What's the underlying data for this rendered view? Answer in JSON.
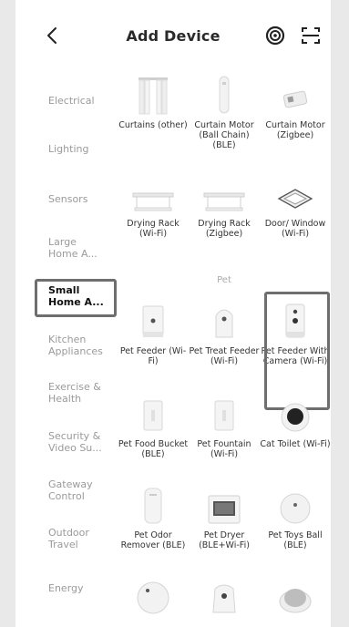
{
  "header": {
    "title": "Add Device",
    "back_icon": "chevron-left-icon",
    "target_icon": "target-icon",
    "scan_icon": "scan-icon"
  },
  "sidebar": {
    "items": [
      {
        "label": "Electrical",
        "active": false
      },
      {
        "label": "Lighting",
        "active": false
      },
      {
        "label": "Sensors",
        "active": false
      },
      {
        "label": "Large Home A...",
        "active": false
      },
      {
        "label": "Small Home A...",
        "active": true
      },
      {
        "label": "Kitchen Appliances",
        "active": false
      },
      {
        "label": "Exercise & Health",
        "active": false
      },
      {
        "label": "Security & Video Su...",
        "active": false
      },
      {
        "label": "Gateway Control",
        "active": false
      },
      {
        "label": "Outdoor Travel",
        "active": false
      },
      {
        "label": "Energy",
        "active": false
      }
    ]
  },
  "sections": {
    "pet_title": "Pet"
  },
  "devices": [
    {
      "label": "Curtains (other)"
    },
    {
      "label": "Curtain Motor (Ball Chain) (BLE)"
    },
    {
      "label": "Curtain Motor (Zigbee)"
    },
    {
      "label": "Drying Rack (Wi-Fi)"
    },
    {
      "label": "Drying Rack (Zigbee)"
    },
    {
      "label": "Door/ Window (Wi-Fi)"
    },
    {
      "label": "Pet Feeder (Wi-Fi)"
    },
    {
      "label": "Pet Treat Feeder (Wi-Fi)"
    },
    {
      "label": "Pet Feeder With Camera (Wi-Fi)"
    },
    {
      "label": "Pet Food Bucket (BLE)"
    },
    {
      "label": "Pet Fountain (Wi-Fi)"
    },
    {
      "label": "Cat Toilet (Wi-Fi)"
    },
    {
      "label": "Pet Odor Remover (BLE)"
    },
    {
      "label": "Pet Dryer (BLE+Wi-Fi)"
    },
    {
      "label": "Pet Toys Ball (BLE)"
    }
  ],
  "colors": {
    "highlight": "#6e6e6e",
    "active_text": "#111111",
    "inactive_text": "#9a9a9a"
  }
}
